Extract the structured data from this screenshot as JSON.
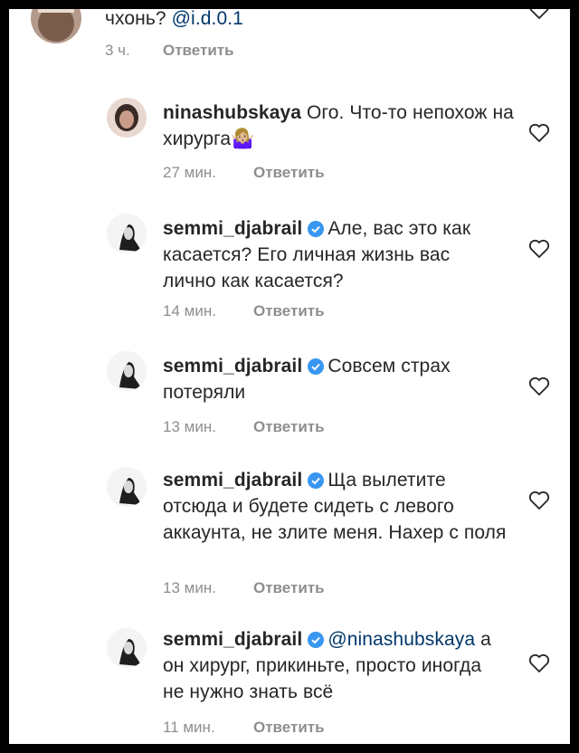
{
  "comments": [
    {
      "username": "",
      "text": "чхонь? ",
      "mention": "@i.d.0.1",
      "time": "3 ч.",
      "reply": "Ответить"
    },
    {
      "username": "ninashubskaya",
      "text": " Ого. Что-то непохож на хирурга🤷🏼‍♀️",
      "time": "27 мин.",
      "reply": "Ответить"
    },
    {
      "username": "semmi_djabrail",
      "text": "Але, вас это как касается? Его личная жизнь вас лично как касается?",
      "time": "14 мин.",
      "reply": "Ответить"
    },
    {
      "username": "semmi_djabrail",
      "text": "Совсем страх потеряли",
      "time": "13 мин.",
      "reply": "Ответить"
    },
    {
      "username": "semmi_djabrail",
      "text": "Ща вылетите отсюда и будете сидеть с левого аккаунта, не злите меня. Нахер с поля",
      "time": "13 мин.",
      "reply": "Ответить"
    },
    {
      "username": "semmi_djabrail",
      "mention": "@ninashubskaya",
      "text": " а он хирург, прикиньте, просто иногда не нужно знать всё",
      "time": "11 мин.",
      "reply": "Ответить"
    }
  ],
  "icons": {
    "like": "heart-icon",
    "verified": "verified-badge-icon"
  },
  "colors": {
    "text": "#262626",
    "meta": "#8e8e8e",
    "mention": "#00376b",
    "verified": "#3897f0"
  }
}
